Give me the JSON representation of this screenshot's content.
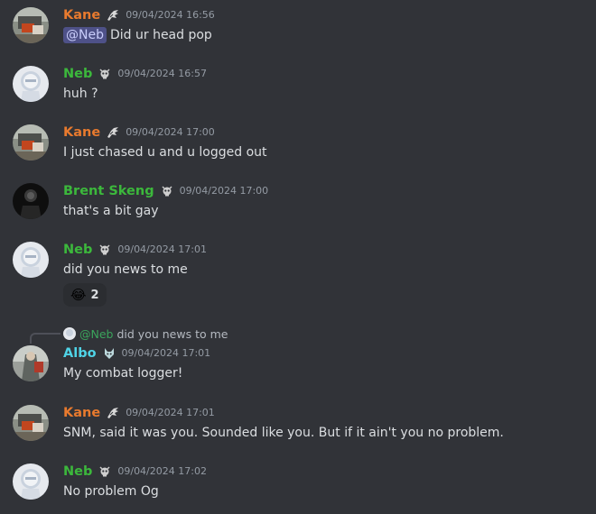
{
  "colors": {
    "background": "#313338",
    "kane": "#e87a2e",
    "neb": "#3cb83c",
    "brent": "#3cb83c",
    "albo": "#4fd3e6",
    "timestamp": "#949ba4",
    "text": "#dbdee1"
  },
  "messages": [
    {
      "author": "Kane",
      "role_icon": "dragon-head-icon",
      "timestamp": "09/04/2024 16:56",
      "mention": "@Neb",
      "text": "Did ur head pop"
    },
    {
      "author": "Neb",
      "role_icon": "skull-icon",
      "timestamp": "09/04/2024 16:57",
      "text": "huh ?"
    },
    {
      "author": "Kane",
      "role_icon": "dragon-head-icon",
      "timestamp": "09/04/2024 17:00",
      "text": "I just chased u and u logged out"
    },
    {
      "author": "Brent Skeng",
      "role_icon": "skull-icon",
      "timestamp": "09/04/2024 17:00",
      "text": "that's a bit gay"
    },
    {
      "author": "Neb",
      "role_icon": "skull-icon",
      "timestamp": "09/04/2024 17:01",
      "text": "did you news to me",
      "reaction": {
        "emoji": "😂",
        "emoji_name": "joy-emoji-icon",
        "count": "2"
      }
    },
    {
      "reply_to": {
        "mention": "@Neb",
        "text": "did you news to me"
      },
      "author": "Albo",
      "role_icon": "wolf-icon",
      "timestamp": "09/04/2024 17:01",
      "text": "My combat logger!"
    },
    {
      "author": "Kane",
      "role_icon": "dragon-head-icon",
      "timestamp": "09/04/2024 17:01",
      "text": "SNM, said it was you. Sounded like you. But if it ain't you no problem."
    },
    {
      "author": "Neb",
      "role_icon": "skull-icon",
      "timestamp": "09/04/2024 17:02",
      "text": "No problem Og"
    }
  ]
}
